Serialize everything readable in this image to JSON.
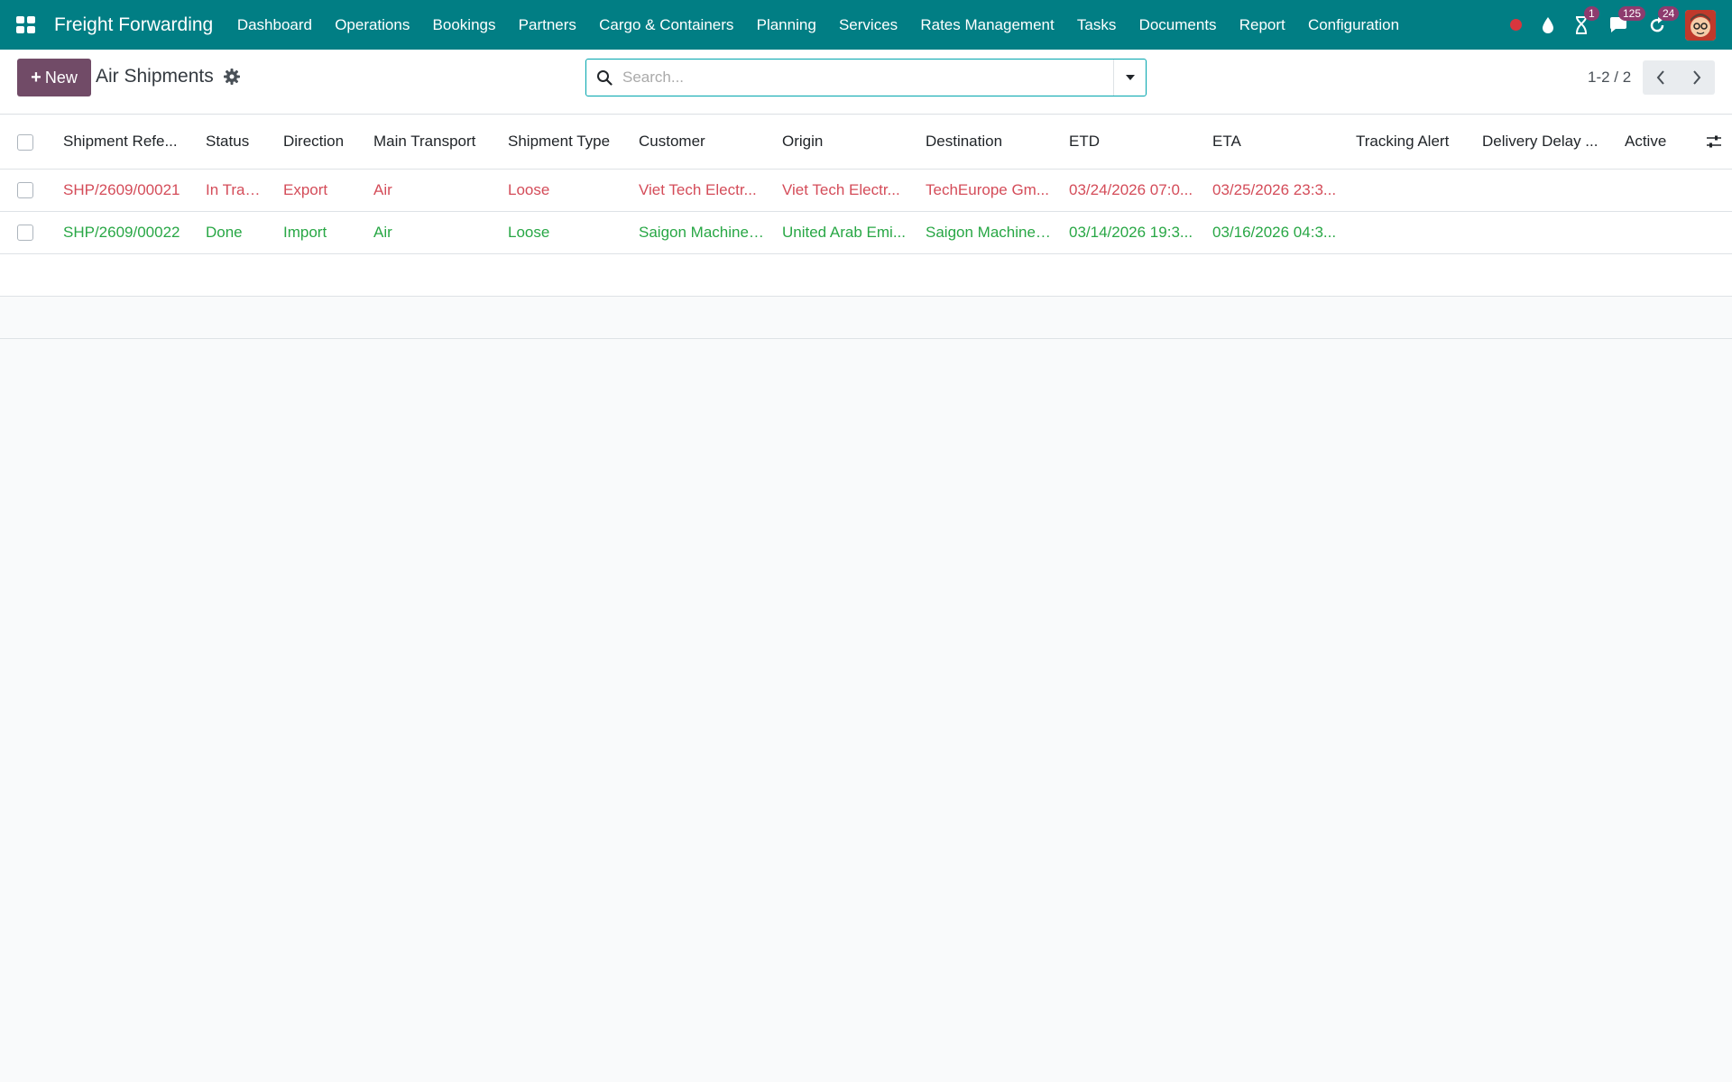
{
  "navbar": {
    "brand": "Freight Forwarding",
    "menu": [
      "Dashboard",
      "Operations",
      "Bookings",
      "Partners",
      "Cargo & Containers",
      "Planning",
      "Services",
      "Rates Management",
      "Tasks",
      "Documents",
      "Report",
      "Configuration"
    ],
    "systray": {
      "activities_badge": "1",
      "messages_badge": "125",
      "updates_badge": "24"
    }
  },
  "control_panel": {
    "new_label": "New",
    "title": "Air Shipments",
    "search_placeholder": "Search...",
    "pager": "1-2 / 2"
  },
  "table": {
    "columns": [
      "Shipment Refe...",
      "Status",
      "Direction",
      "Main Transport",
      "Shipment Type",
      "Customer",
      "Origin",
      "Destination",
      "ETD",
      "ETA",
      "Tracking Alert",
      "Delivery Delay ...",
      "Active"
    ],
    "rows": [
      {
        "state": "danger",
        "reference": "SHP/2609/00021",
        "status": "In Transit",
        "direction": "Export",
        "transport": "Air",
        "type": "Loose",
        "customer": "Viet Tech Electr...",
        "origin": "Viet Tech Electr...",
        "destination": "TechEurope Gm...",
        "etd": "03/24/2026 07:0...",
        "eta": "03/25/2026 23:3...",
        "tracking_alert": "",
        "delivery_delay": "",
        "active": ""
      },
      {
        "state": "success",
        "reference": "SHP/2609/00022",
        "status": "Done",
        "direction": "Import",
        "transport": "Air",
        "type": "Loose",
        "customer": "Saigon Machiner...",
        "origin": "United Arab Emi...",
        "destination": "Saigon Machiner...",
        "etd": "03/14/2026 19:3...",
        "eta": "03/16/2026 04:3...",
        "tracking_alert": "",
        "delivery_delay": "",
        "active": ""
      }
    ]
  },
  "colors": {
    "navbar": "#017e84",
    "primary": "#714b67",
    "danger_row": "#d44c59",
    "success_row": "#28a745"
  }
}
